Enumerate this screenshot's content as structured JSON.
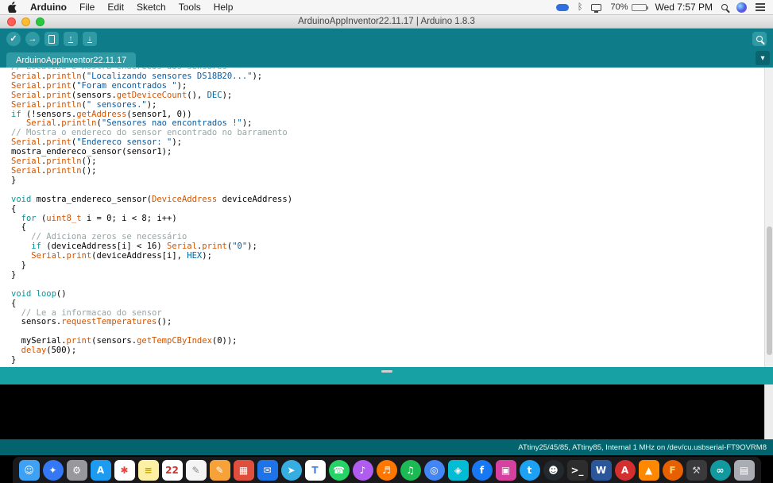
{
  "menu_bar": {
    "app_name": "Arduino",
    "items": [
      "File",
      "Edit",
      "Sketch",
      "Tools",
      "Help"
    ],
    "status": {
      "battery": "70%",
      "clock": "Wed 7:57 PM"
    }
  },
  "window": {
    "title": "ArduinoAppInventor22.11.17 | Arduino 1.8.3"
  },
  "toolbar": {
    "verify": "verify",
    "upload": "upload",
    "new": "new",
    "open": "open",
    "save": "save",
    "serial_monitor": "serial-monitor"
  },
  "tab": {
    "label": "ArduinoAppInventor22.11.17"
  },
  "editor": {
    "lines": [
      [
        [
          "c",
          "// Localiza e mostra enderecos dos sensores"
        ]
      ],
      [
        [
          "f",
          "Serial"
        ],
        [
          "d",
          "."
        ],
        [
          "f",
          "println"
        ],
        [
          "d",
          "("
        ],
        [
          "s",
          "\"Localizando sensores DS18B20...\""
        ],
        [
          "d",
          ");"
        ]
      ],
      [
        [
          "f",
          "Serial"
        ],
        [
          "d",
          "."
        ],
        [
          "f",
          "print"
        ],
        [
          "d",
          "("
        ],
        [
          "s",
          "\"Foram encontrados \""
        ],
        [
          "d",
          ");"
        ]
      ],
      [
        [
          "f",
          "Serial"
        ],
        [
          "d",
          "."
        ],
        [
          "f",
          "print"
        ],
        [
          "d",
          "(sensors."
        ],
        [
          "f",
          "getDeviceCount"
        ],
        [
          "d",
          "(), "
        ],
        [
          "l",
          "DEC"
        ],
        [
          "d",
          ");"
        ]
      ],
      [
        [
          "f",
          "Serial"
        ],
        [
          "d",
          "."
        ],
        [
          "f",
          "println"
        ],
        [
          "d",
          "("
        ],
        [
          "s",
          "\" sensores.\""
        ],
        [
          "d",
          ");"
        ]
      ],
      [
        [
          "k",
          "if"
        ],
        [
          "d",
          " (!sensors."
        ],
        [
          "f",
          "getAddress"
        ],
        [
          "d",
          "(sensor1, 0))"
        ]
      ],
      [
        [
          "d",
          "   "
        ],
        [
          "f",
          "Serial"
        ],
        [
          "d",
          "."
        ],
        [
          "f",
          "println"
        ],
        [
          "d",
          "("
        ],
        [
          "s",
          "\"Sensores nao encontrados !\""
        ],
        [
          "d",
          ");"
        ]
      ],
      [
        [
          "c",
          "// Mostra o endereco do sensor encontrado no barramento"
        ]
      ],
      [
        [
          "f",
          "Serial"
        ],
        [
          "d",
          "."
        ],
        [
          "f",
          "print"
        ],
        [
          "d",
          "("
        ],
        [
          "s",
          "\"Endereco sensor: \""
        ],
        [
          "d",
          ");"
        ]
      ],
      [
        [
          "d",
          "mostra_endereco_sensor(sensor1);"
        ]
      ],
      [
        [
          "f",
          "Serial"
        ],
        [
          "d",
          "."
        ],
        [
          "f",
          "println"
        ],
        [
          "d",
          "();"
        ]
      ],
      [
        [
          "f",
          "Serial"
        ],
        [
          "d",
          "."
        ],
        [
          "f",
          "println"
        ],
        [
          "d",
          "();"
        ]
      ],
      [
        [
          "d",
          "}"
        ]
      ],
      [],
      [
        [
          "k",
          "void"
        ],
        [
          "d",
          " mostra_endereco_sensor("
        ],
        [
          "f",
          "DeviceAddress"
        ],
        [
          "d",
          " deviceAddress)"
        ]
      ],
      [
        [
          "d",
          "{"
        ]
      ],
      [
        [
          "d",
          "  "
        ],
        [
          "k",
          "for"
        ],
        [
          "d",
          " ("
        ],
        [
          "f",
          "uint8_t"
        ],
        [
          "d",
          " i = 0; i < 8; i++)"
        ]
      ],
      [
        [
          "d",
          "  {"
        ]
      ],
      [
        [
          "d",
          "    "
        ],
        [
          "c",
          "// Adiciona zeros se necessário"
        ]
      ],
      [
        [
          "d",
          "    "
        ],
        [
          "k",
          "if"
        ],
        [
          "d",
          " (deviceAddress[i] < 16) "
        ],
        [
          "f",
          "Serial"
        ],
        [
          "d",
          "."
        ],
        [
          "f",
          "print"
        ],
        [
          "d",
          "("
        ],
        [
          "s",
          "\"0\""
        ],
        [
          "d",
          ");"
        ]
      ],
      [
        [
          "d",
          "    "
        ],
        [
          "f",
          "Serial"
        ],
        [
          "d",
          "."
        ],
        [
          "f",
          "print"
        ],
        [
          "d",
          "(deviceAddress[i], "
        ],
        [
          "l",
          "HEX"
        ],
        [
          "d",
          ");"
        ]
      ],
      [
        [
          "d",
          "  }"
        ]
      ],
      [
        [
          "d",
          "}"
        ]
      ],
      [],
      [
        [
          "k",
          "void"
        ],
        [
          "d",
          " "
        ],
        [
          "k",
          "loop"
        ],
        [
          "d",
          "()"
        ]
      ],
      [
        [
          "d",
          "{"
        ]
      ],
      [
        [
          "d",
          "  "
        ],
        [
          "c",
          "// Le a informacao do sensor"
        ]
      ],
      [
        [
          "d",
          "  sensors."
        ],
        [
          "f",
          "requestTemperatures"
        ],
        [
          "d",
          "();"
        ]
      ],
      [],
      [
        [
          "d",
          "  mySerial."
        ],
        [
          "f",
          "print"
        ],
        [
          "d",
          "(sensors."
        ],
        [
          "f",
          "getTempCByIndex"
        ],
        [
          "d",
          "(0));"
        ]
      ],
      [
        [
          "d",
          "  "
        ],
        [
          "f",
          "delay"
        ],
        [
          "d",
          "(500);"
        ]
      ],
      [
        [
          "d",
          "}"
        ]
      ]
    ]
  },
  "statusbar": {
    "message": ""
  },
  "console": {
    "text": ""
  },
  "infobar": {
    "text": "ATtiny25/45/85, ATtiny85, Internal 1 MHz on /dev/cu.usbserial-FT9OVRM8"
  },
  "dock": {
    "items": [
      {
        "name": "finder",
        "glyph": "☺",
        "bg": "#3da2f5",
        "fg": "#ffffff",
        "shape": "square"
      },
      {
        "name": "safari",
        "glyph": "✦",
        "bg": "#3478f6",
        "fg": "#ffffff",
        "shape": "circle"
      },
      {
        "name": "system-preferences",
        "glyph": "⚙",
        "bg": "#97979c",
        "fg": "#ffffff",
        "shape": "square"
      },
      {
        "name": "app-store",
        "glyph": "A",
        "bg": "#1d9bf0",
        "fg": "#ffffff",
        "shape": "square"
      },
      {
        "name": "photos",
        "glyph": "✱",
        "bg": "#ffffff",
        "fg": "#e8453c",
        "shape": "square"
      },
      {
        "name": "notes",
        "glyph": "≡",
        "bg": "#fdf0a4",
        "fg": "#c7a500",
        "shape": "square"
      },
      {
        "name": "calendar",
        "glyph": "22",
        "bg": "#ffffff",
        "fg": "#d0342c",
        "shape": "square"
      },
      {
        "name": "textedit",
        "glyph": "✎",
        "bg": "#f4f4f4",
        "fg": "#8a8a8a",
        "shape": "square"
      },
      {
        "name": "pages",
        "glyph": "✎",
        "bg": "#f7a239",
        "fg": "#ffffff",
        "shape": "square"
      },
      {
        "name": "keynote",
        "glyph": "▦",
        "bg": "#e04f3e",
        "fg": "#ffffff",
        "shape": "square"
      },
      {
        "name": "mail",
        "glyph": "✉",
        "bg": "#1e73e8",
        "fg": "#ffffff",
        "shape": "square"
      },
      {
        "name": "telegram",
        "glyph": "➤",
        "bg": "#37aee2",
        "fg": "#ffffff",
        "shape": "circle"
      },
      {
        "name": "translate",
        "glyph": "T",
        "bg": "#ffffff",
        "fg": "#4285f4",
        "shape": "square"
      },
      {
        "name": "whatsapp",
        "glyph": "☎",
        "bg": "#25d366",
        "fg": "#ffffff",
        "shape": "circle"
      },
      {
        "name": "itunes",
        "glyph": "♪",
        "bg": "#b05cf0",
        "fg": "#ffffff",
        "shape": "circle"
      },
      {
        "name": "soundcloud",
        "glyph": "♬",
        "bg": "#ff7700",
        "fg": "#ffffff",
        "shape": "circle"
      },
      {
        "name": "spotify",
        "glyph": "♫",
        "bg": "#1db954",
        "fg": "#ffffff",
        "shape": "circle"
      },
      {
        "name": "chrome",
        "glyph": "◎",
        "bg": "#4285f4",
        "fg": "#ffffff",
        "shape": "circle"
      },
      {
        "name": "sketch",
        "glyph": "◈",
        "bg": "#00bcd4",
        "fg": "#ffffff",
        "shape": "square"
      },
      {
        "name": "facebook",
        "glyph": "f",
        "bg": "#1877f2",
        "fg": "#ffffff",
        "shape": "circle"
      },
      {
        "name": "instagram",
        "glyph": "▣",
        "bg": "#d6409f",
        "fg": "#ffffff",
        "shape": "square"
      },
      {
        "name": "twitter",
        "glyph": "t",
        "bg": "#1da1f2",
        "fg": "#ffffff",
        "shape": "circle"
      },
      {
        "name": "github",
        "glyph": "☻",
        "bg": "#24292e",
        "fg": "#ffffff",
        "shape": "circle"
      },
      {
        "name": "terminal",
        "glyph": ">_",
        "bg": "#2d2d2d",
        "fg": "#ffffff",
        "shape": "square"
      },
      {
        "name": "word",
        "glyph": "W",
        "bg": "#2b579a",
        "fg": "#ffffff",
        "shape": "square"
      },
      {
        "name": "acrobat",
        "glyph": "A",
        "bg": "#d32f2f",
        "fg": "#ffffff",
        "shape": "circle"
      },
      {
        "name": "vlc",
        "glyph": "▲",
        "bg": "#ff8800",
        "fg": "#ffffff",
        "shape": "square"
      },
      {
        "name": "firefox",
        "glyph": "F",
        "bg": "#e66000",
        "fg": "#ffd178",
        "shape": "circle"
      },
      {
        "name": "utilities",
        "glyph": "⚒",
        "bg": "#3a3a3c",
        "fg": "#cfcfcf",
        "shape": "square"
      },
      {
        "name": "arduino",
        "glyph": "∞",
        "bg": "#12999f",
        "fg": "#ffffff",
        "shape": "circle"
      },
      {
        "name": "trash",
        "glyph": "▤",
        "bg": "#a9adb3",
        "fg": "#ffffff",
        "shape": "square"
      }
    ]
  },
  "colors": {
    "arduino_teal_toolbar": "#0e7d89",
    "arduino_teal_status": "#17A1A5",
    "arduino_teal_infobar": "#04646d",
    "button_teal": "#2f99a4",
    "syntax_keyword": "#00979C",
    "syntax_function": "#D35400",
    "syntax_string": "#0b5a9e",
    "syntax_comment": "#95A5A6",
    "syntax_literal": "#006699"
  }
}
